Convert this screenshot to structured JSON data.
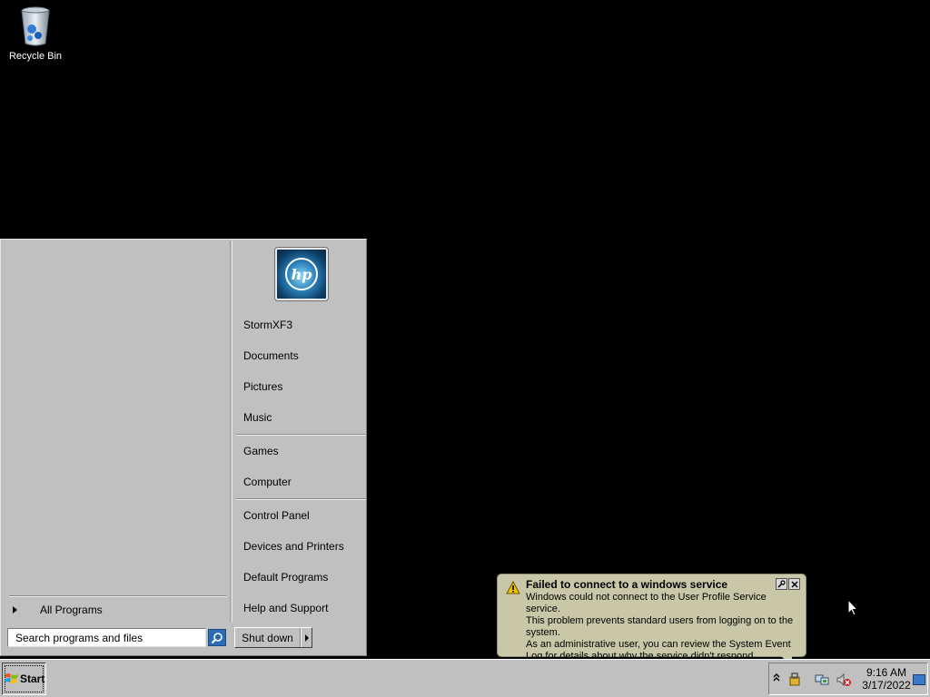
{
  "desktop": {
    "icons": [
      {
        "label": "Recycle Bin",
        "icon": "recycle-bin-icon"
      }
    ]
  },
  "start_menu": {
    "right_items": [
      {
        "label": "StormXF3"
      },
      {
        "label": "Documents"
      },
      {
        "label": "Pictures"
      },
      {
        "label": "Music"
      },
      {
        "label": "Games"
      },
      {
        "label": "Computer"
      },
      {
        "label": "Control Panel"
      },
      {
        "label": "Devices and Printers"
      },
      {
        "label": "Default Programs"
      },
      {
        "label": "Help and Support"
      }
    ],
    "all_programs_label": "All Programs",
    "search_placeholder": "Search programs and files",
    "shutdown_label": "Shut down",
    "user_picture": "hp"
  },
  "balloon": {
    "title": "Failed to connect to a windows service",
    "body_lines": [
      "Windows could not connect to the User Profile Service service.",
      "This problem prevents standard users from logging on to the system.",
      "As an administrative user, you can review the System Event Log for details about why the service didn't respond."
    ],
    "icon": "warning-icon"
  },
  "taskbar": {
    "start_label": "Start",
    "clock_time": "9:16 AM",
    "clock_date": "3/17/2022"
  }
}
